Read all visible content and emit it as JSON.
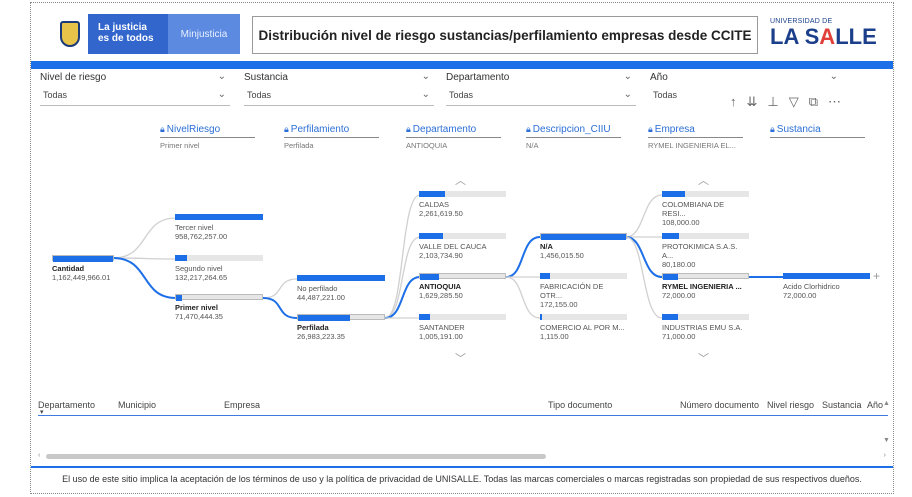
{
  "header": {
    "brand_line1": "La justicia",
    "brand_line2": "es de todos",
    "ministry": "Minjusticia",
    "title": "Distribución nivel de riesgo sustancias/perfilamiento empresas desde CCITE",
    "university_top": "UNIVERSIDAD DE",
    "university_name_a": "LA S",
    "university_name_b": "A",
    "university_name_c": "LLE"
  },
  "filters": [
    {
      "label": "Nivel de riesgo",
      "value": "Todas"
    },
    {
      "label": "Sustancia",
      "value": "Todas"
    },
    {
      "label": "Departamento",
      "value": "Todas"
    },
    {
      "label": "Año",
      "value": "Todas"
    }
  ],
  "toolbar": {
    "icons": [
      "arrow-up-icon",
      "double-arrow-down-icon",
      "expand-hierarchy-icon",
      "filter-icon",
      "focus-mode-icon",
      "more-options-icon"
    ]
  },
  "tree": {
    "headers": [
      {
        "name": "NivelRiesgo",
        "sub": "Primer nivel"
      },
      {
        "name": "Perfilamiento",
        "sub": "Perfilada"
      },
      {
        "name": "Departamento",
        "sub": "ANTIOQUIA"
      },
      {
        "name": "Descripcion_CIIU",
        "sub": "N/A"
      },
      {
        "name": "Empresa",
        "sub": "RYMEL INGENIERIA EL..."
      },
      {
        "name": "Sustancia",
        "sub": ""
      }
    ],
    "root": {
      "label": "Cantidad",
      "value": "1,162,449,966.01",
      "fill": 1.0
    },
    "nivel": [
      {
        "label": "Tercer nivel",
        "value": "958,762,257.00",
        "fill": 1.0
      },
      {
        "label": "Segundo nivel",
        "value": "132,217,264.65",
        "fill": 0.14
      },
      {
        "label": "Primer nivel",
        "value": "71,470,444.35",
        "fill": 0.07,
        "selected": true
      }
    ],
    "perfil": [
      {
        "label": "No perfilado",
        "value": "44,487,221.00",
        "fill": 1.0
      },
      {
        "label": "Perfilada",
        "value": "26,983,223.35",
        "fill": 0.6,
        "selected": true
      }
    ],
    "departamento": [
      {
        "label": "CALDAS",
        "value": "2,261,619.50",
        "fill": 0.3
      },
      {
        "label": "VALLE DEL CAUCA",
        "value": "2,103,734.90",
        "fill": 0.28
      },
      {
        "label": "ANTIOQUIA",
        "value": "1,629,285.50",
        "fill": 0.22,
        "selected": true
      },
      {
        "label": "SANTANDER",
        "value": "1,005,191.00",
        "fill": 0.13
      }
    ],
    "ciiu": [
      {
        "label": "N/A",
        "value": "1,456,015.50",
        "fill": 1.0,
        "selected": true
      },
      {
        "label": "FABRICACIÓN DE OTR...",
        "value": "172,155.00",
        "fill": 0.12
      },
      {
        "label": "COMERCIO AL POR M...",
        "value": "1,115.00",
        "fill": 0.01
      }
    ],
    "empresa": [
      {
        "label": "COLOMBIANA DE RESI...",
        "value": "108,000.00",
        "fill": 0.27
      },
      {
        "label": "PROTOKIMICA S.A.S. A...",
        "value": "80,180.00",
        "fill": 0.2
      },
      {
        "label": "RYMEL INGENIERIA ...",
        "value": "72,000.00",
        "fill": 0.18,
        "selected": true
      },
      {
        "label": "INDUSTRIAS EMU S.A.",
        "value": "71,000.00",
        "fill": 0.18
      }
    ],
    "sustancia": [
      {
        "label": "Acido Clorhidrico",
        "value": "72,000.00",
        "fill": 1.0
      }
    ]
  },
  "table": {
    "columns": [
      "Departamento",
      "Municipio",
      "Empresa",
      "Tipo documento",
      "Número documento",
      "Nivel riesgo",
      "Sustancia",
      "Año"
    ]
  },
  "footer": {
    "text": "El uso de este sitio implica la aceptación de los términos de uso y la política de privacidad de UNISALLE. Todas las marcas comerciales o marcas registradas son propiedad de sus respectivos dueños."
  },
  "colors": {
    "accent": "#1d6fe8",
    "brand_blue": "#3366cc",
    "track": "#e6e6e6"
  }
}
